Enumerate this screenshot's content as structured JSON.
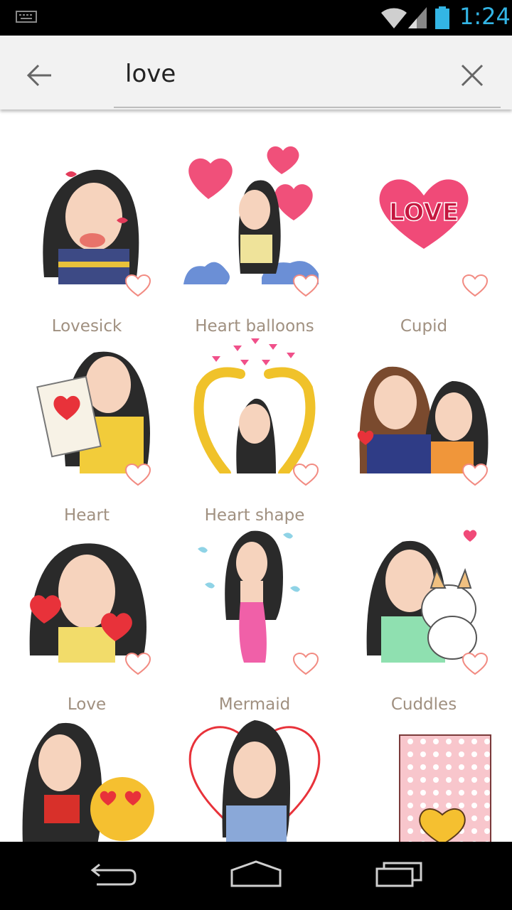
{
  "status": {
    "time": "1:24"
  },
  "search": {
    "query": "love"
  },
  "results": [
    {
      "label": "Lovesick"
    },
    {
      "label": "Heart balloons"
    },
    {
      "label": "Cupid"
    },
    {
      "label": "Heart"
    },
    {
      "label": "Heart shape"
    },
    {
      "label": ""
    },
    {
      "label": "Love"
    },
    {
      "label": "Mermaid"
    },
    {
      "label": "Cuddles"
    },
    {
      "label": ""
    },
    {
      "label": ""
    },
    {
      "label": ""
    }
  ],
  "sticker_badge": "LOVE"
}
